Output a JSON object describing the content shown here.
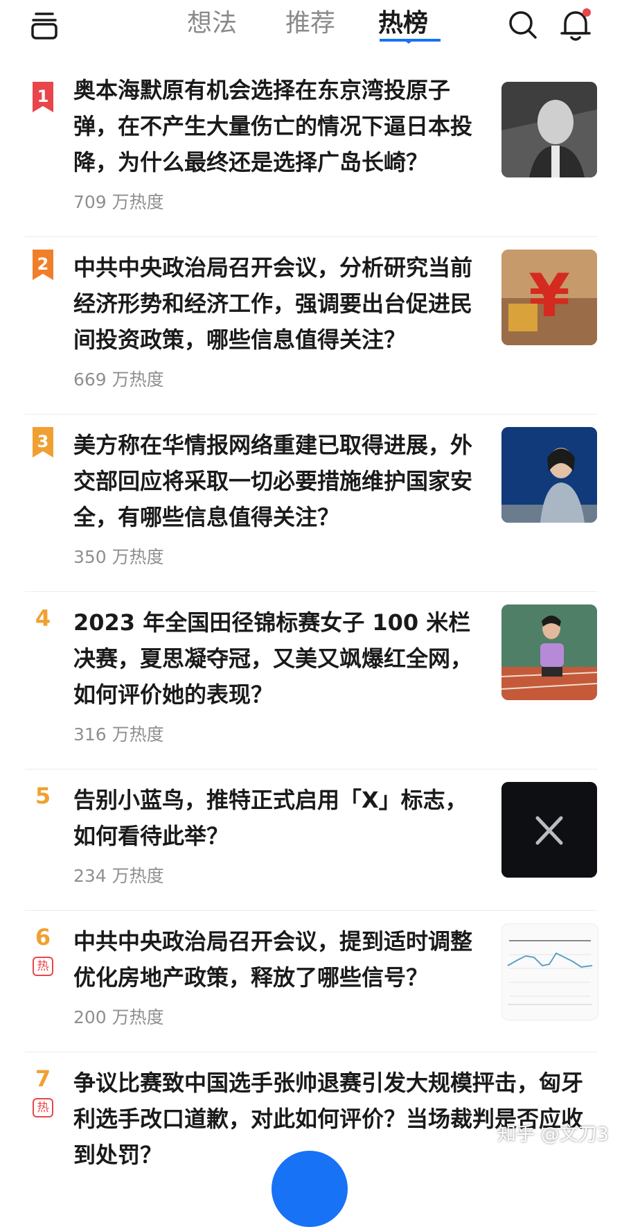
{
  "header": {
    "tabs": [
      {
        "label": "想法"
      },
      {
        "label": "推荐"
      },
      {
        "label": "热榜",
        "active": true
      }
    ],
    "colors": {
      "accent": "#1772f6",
      "notification_dot": "#e8464a"
    }
  },
  "hot_list": [
    {
      "rank": "1",
      "title": "奥本海默原有机会选择在东京湾投原子弹，在不产生大量伤亡的情况下逼日本投降，为什么最终还是选择广岛长崎？",
      "heat": "709 万热度",
      "thumb_icon": "photo-portrait-scientist"
    },
    {
      "rank": "2",
      "title": "中共中央政治局召开会议，分析研究当前经济形势和经济工作，强调要出台促进民间投资政策，哪些信息值得关注？",
      "heat": "669 万热度",
      "thumb_icon": "photo-yuan-symbol"
    },
    {
      "rank": "3",
      "title": "美方称在华情报网络重建已取得进展，外交部回应将采取一切必要措施维护国家安全，有哪些信息值得关注？",
      "heat": "350 万热度",
      "thumb_icon": "photo-spokesperson"
    },
    {
      "rank": "4",
      "title": "2023 年全国田径锦标赛女子 100 米栏决赛，夏思凝夺冠，又美又飒爆红全网，如何评价她的表现？",
      "heat": "316 万热度",
      "thumb_icon": "photo-athlete"
    },
    {
      "rank": "5",
      "title": "告别小蓝鸟，推特正式启用「X」标志，如何看待此举？",
      "heat": "234 万热度",
      "thumb_icon": "x-logo"
    },
    {
      "rank": "6",
      "hot_tag": "热",
      "title": "中共中央政治局召开会议，提到适时调整优化房地产政策，释放了哪些信号？",
      "heat": "200 万热度",
      "thumb_icon": "line-chart-thumbnail"
    },
    {
      "rank": "7",
      "hot_tag": "热",
      "title": "争议比赛致中国选手张帅退赛引发大规模抨击，匈牙利选手改口道歉，对此如何评价？当场裁判是否应收到处罚？"
    }
  ],
  "rank_colors": {
    "1": "#e8464a",
    "2": "#f07f2a",
    "3": "#f0a032",
    "other": "#f0a032"
  },
  "watermark": "知乎 @文刀3"
}
